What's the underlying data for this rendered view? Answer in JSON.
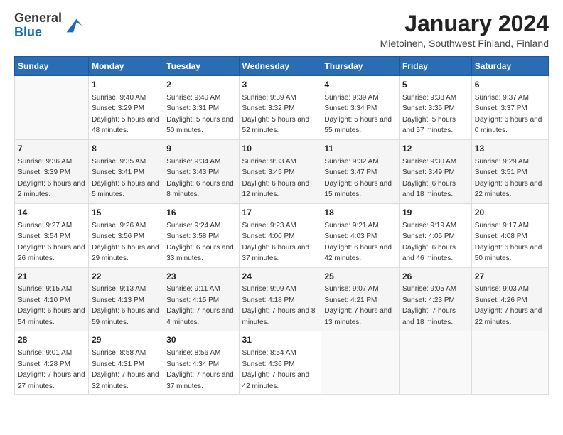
{
  "logo": {
    "general": "General",
    "blue": "Blue"
  },
  "title": "January 2024",
  "location": "Mietoinen, Southwest Finland, Finland",
  "days_of_week": [
    "Sunday",
    "Monday",
    "Tuesday",
    "Wednesday",
    "Thursday",
    "Friday",
    "Saturday"
  ],
  "weeks": [
    [
      {
        "num": "",
        "sunrise": "",
        "sunset": "",
        "daylight": ""
      },
      {
        "num": "1",
        "sunrise": "Sunrise: 9:40 AM",
        "sunset": "Sunset: 3:29 PM",
        "daylight": "Daylight: 5 hours and 48 minutes."
      },
      {
        "num": "2",
        "sunrise": "Sunrise: 9:40 AM",
        "sunset": "Sunset: 3:31 PM",
        "daylight": "Daylight: 5 hours and 50 minutes."
      },
      {
        "num": "3",
        "sunrise": "Sunrise: 9:39 AM",
        "sunset": "Sunset: 3:32 PM",
        "daylight": "Daylight: 5 hours and 52 minutes."
      },
      {
        "num": "4",
        "sunrise": "Sunrise: 9:39 AM",
        "sunset": "Sunset: 3:34 PM",
        "daylight": "Daylight: 5 hours and 55 minutes."
      },
      {
        "num": "5",
        "sunrise": "Sunrise: 9:38 AM",
        "sunset": "Sunset: 3:35 PM",
        "daylight": "Daylight: 5 hours and 57 minutes."
      },
      {
        "num": "6",
        "sunrise": "Sunrise: 9:37 AM",
        "sunset": "Sunset: 3:37 PM",
        "daylight": "Daylight: 6 hours and 0 minutes."
      }
    ],
    [
      {
        "num": "7",
        "sunrise": "Sunrise: 9:36 AM",
        "sunset": "Sunset: 3:39 PM",
        "daylight": "Daylight: 6 hours and 2 minutes."
      },
      {
        "num": "8",
        "sunrise": "Sunrise: 9:35 AM",
        "sunset": "Sunset: 3:41 PM",
        "daylight": "Daylight: 6 hours and 5 minutes."
      },
      {
        "num": "9",
        "sunrise": "Sunrise: 9:34 AM",
        "sunset": "Sunset: 3:43 PM",
        "daylight": "Daylight: 6 hours and 8 minutes."
      },
      {
        "num": "10",
        "sunrise": "Sunrise: 9:33 AM",
        "sunset": "Sunset: 3:45 PM",
        "daylight": "Daylight: 6 hours and 12 minutes."
      },
      {
        "num": "11",
        "sunrise": "Sunrise: 9:32 AM",
        "sunset": "Sunset: 3:47 PM",
        "daylight": "Daylight: 6 hours and 15 minutes."
      },
      {
        "num": "12",
        "sunrise": "Sunrise: 9:30 AM",
        "sunset": "Sunset: 3:49 PM",
        "daylight": "Daylight: 6 hours and 18 minutes."
      },
      {
        "num": "13",
        "sunrise": "Sunrise: 9:29 AM",
        "sunset": "Sunset: 3:51 PM",
        "daylight": "Daylight: 6 hours and 22 minutes."
      }
    ],
    [
      {
        "num": "14",
        "sunrise": "Sunrise: 9:27 AM",
        "sunset": "Sunset: 3:54 PM",
        "daylight": "Daylight: 6 hours and 26 minutes."
      },
      {
        "num": "15",
        "sunrise": "Sunrise: 9:26 AM",
        "sunset": "Sunset: 3:56 PM",
        "daylight": "Daylight: 6 hours and 29 minutes."
      },
      {
        "num": "16",
        "sunrise": "Sunrise: 9:24 AM",
        "sunset": "Sunset: 3:58 PM",
        "daylight": "Daylight: 6 hours and 33 minutes."
      },
      {
        "num": "17",
        "sunrise": "Sunrise: 9:23 AM",
        "sunset": "Sunset: 4:00 PM",
        "daylight": "Daylight: 6 hours and 37 minutes."
      },
      {
        "num": "18",
        "sunrise": "Sunrise: 9:21 AM",
        "sunset": "Sunset: 4:03 PM",
        "daylight": "Daylight: 6 hours and 42 minutes."
      },
      {
        "num": "19",
        "sunrise": "Sunrise: 9:19 AM",
        "sunset": "Sunset: 4:05 PM",
        "daylight": "Daylight: 6 hours and 46 minutes."
      },
      {
        "num": "20",
        "sunrise": "Sunrise: 9:17 AM",
        "sunset": "Sunset: 4:08 PM",
        "daylight": "Daylight: 6 hours and 50 minutes."
      }
    ],
    [
      {
        "num": "21",
        "sunrise": "Sunrise: 9:15 AM",
        "sunset": "Sunset: 4:10 PM",
        "daylight": "Daylight: 6 hours and 54 minutes."
      },
      {
        "num": "22",
        "sunrise": "Sunrise: 9:13 AM",
        "sunset": "Sunset: 4:13 PM",
        "daylight": "Daylight: 6 hours and 59 minutes."
      },
      {
        "num": "23",
        "sunrise": "Sunrise: 9:11 AM",
        "sunset": "Sunset: 4:15 PM",
        "daylight": "Daylight: 7 hours and 4 minutes."
      },
      {
        "num": "24",
        "sunrise": "Sunrise: 9:09 AM",
        "sunset": "Sunset: 4:18 PM",
        "daylight": "Daylight: 7 hours and 8 minutes."
      },
      {
        "num": "25",
        "sunrise": "Sunrise: 9:07 AM",
        "sunset": "Sunset: 4:21 PM",
        "daylight": "Daylight: 7 hours and 13 minutes."
      },
      {
        "num": "26",
        "sunrise": "Sunrise: 9:05 AM",
        "sunset": "Sunset: 4:23 PM",
        "daylight": "Daylight: 7 hours and 18 minutes."
      },
      {
        "num": "27",
        "sunrise": "Sunrise: 9:03 AM",
        "sunset": "Sunset: 4:26 PM",
        "daylight": "Daylight: 7 hours and 22 minutes."
      }
    ],
    [
      {
        "num": "28",
        "sunrise": "Sunrise: 9:01 AM",
        "sunset": "Sunset: 4:28 PM",
        "daylight": "Daylight: 7 hours and 27 minutes."
      },
      {
        "num": "29",
        "sunrise": "Sunrise: 8:58 AM",
        "sunset": "Sunset: 4:31 PM",
        "daylight": "Daylight: 7 hours and 32 minutes."
      },
      {
        "num": "30",
        "sunrise": "Sunrise: 8:56 AM",
        "sunset": "Sunset: 4:34 PM",
        "daylight": "Daylight: 7 hours and 37 minutes."
      },
      {
        "num": "31",
        "sunrise": "Sunrise: 8:54 AM",
        "sunset": "Sunset: 4:36 PM",
        "daylight": "Daylight: 7 hours and 42 minutes."
      },
      {
        "num": "",
        "sunrise": "",
        "sunset": "",
        "daylight": ""
      },
      {
        "num": "",
        "sunrise": "",
        "sunset": "",
        "daylight": ""
      },
      {
        "num": "",
        "sunrise": "",
        "sunset": "",
        "daylight": ""
      }
    ]
  ]
}
